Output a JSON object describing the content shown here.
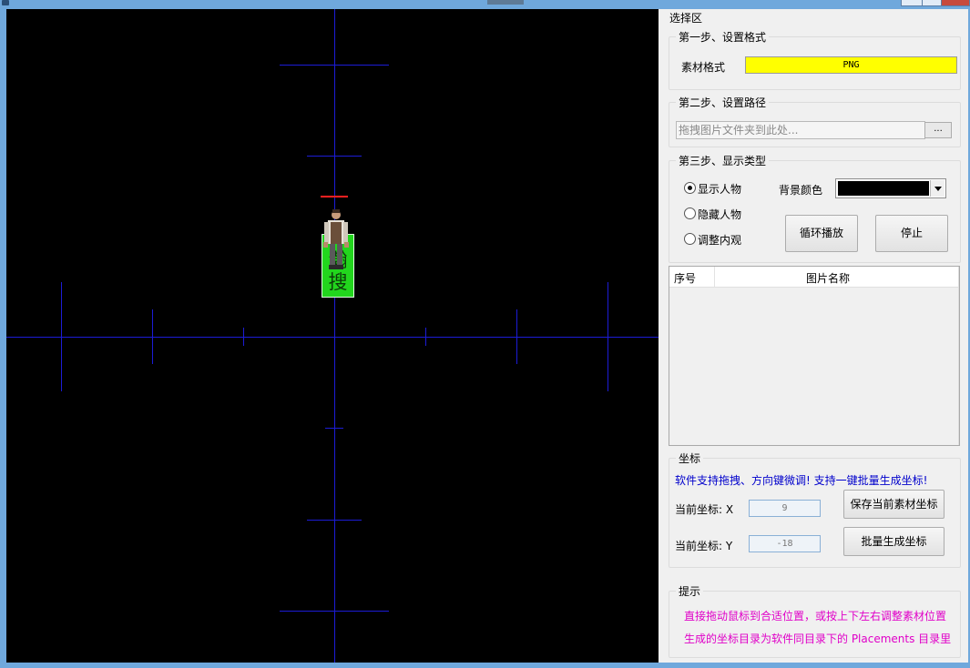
{
  "window": {
    "title": ""
  },
  "canvas": {
    "sprite_label": [
      "瀚",
      "搜"
    ]
  },
  "panel": {
    "section_title": "选择区",
    "step1": {
      "title": "第一步、设置格式",
      "label": "素材格式",
      "value": "PNG"
    },
    "step2": {
      "title": "第二步、设置路径",
      "placeholder": "拖拽图片文件夹到此处...",
      "browse": "..."
    },
    "step3": {
      "title": "第三步、显示类型",
      "radios": [
        {
          "label": "显示人物",
          "checked": true
        },
        {
          "label": "隐藏人物",
          "checked": false
        },
        {
          "label": "调整内观",
          "checked": false
        }
      ],
      "bg_color_label": "背景颜色",
      "bg_color_value": "#000000",
      "loop_btn": "循环播放",
      "stop_btn": "停止"
    },
    "list": {
      "col1": "序号",
      "col2": "图片名称",
      "rows": []
    },
    "coords": {
      "title": "坐标",
      "note": "软件支持拖拽、方向键微调! 支持一键批量生成坐标!",
      "x_label": "当前坐标: X",
      "x_value": "9",
      "y_label": "当前坐标: Y",
      "y_value": "-18",
      "save_btn": "保存当前素材坐标",
      "batch_btn": "批量生成坐标"
    },
    "hints": {
      "title": "提示",
      "line1": "直接拖动鼠标到合适位置，或按上下左右调整素材位置",
      "line2": "生成的坐标目录为软件同目录下的 Placements 目录里"
    }
  },
  "colors": {
    "accent_yellow": "#ffff00",
    "sprite_green": "#22d61d",
    "axis_blue": "#1c1cd6",
    "hint_pink": "#e000c8",
    "note_blue": "#0000cc"
  }
}
